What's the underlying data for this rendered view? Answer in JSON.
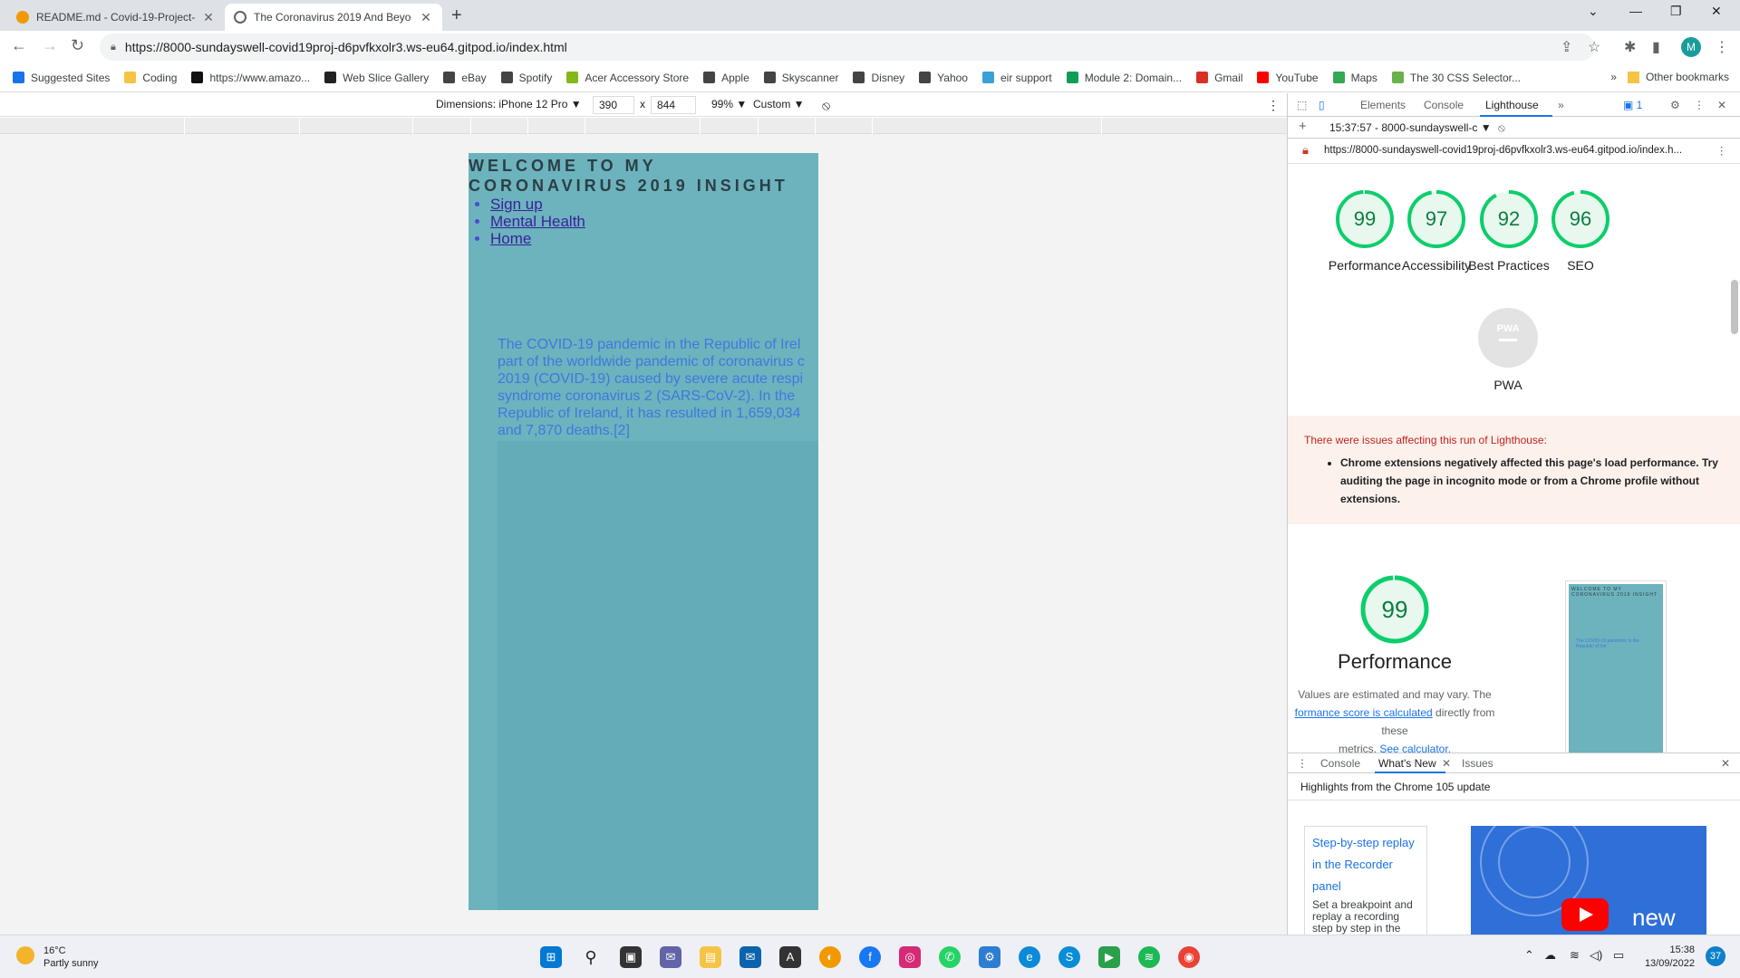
{
  "browser": {
    "tabs": [
      {
        "title": "README.md - Covid-19-Project-",
        "favicon_color": "#f29900"
      },
      {
        "title": "The Coronavirus 2019 And Beyo",
        "favicon_color": "#5f6368"
      }
    ],
    "url": "https://8000-sundayswell-covid19proj-d6pvfkxolr3.ws-eu64.gitpod.io/index.html",
    "profile_initial": "M"
  },
  "bookmarks": {
    "items": [
      {
        "label": "Suggested Sites",
        "icon": "search-icon",
        "color": "#1a73e8"
      },
      {
        "label": "Coding",
        "icon": "folder-icon",
        "color": "#f6c445"
      },
      {
        "label": "https://www.amazo...",
        "icon": "amazon-icon",
        "color": "#111111"
      },
      {
        "label": "Web Slice Gallery",
        "icon": "web-slice-icon",
        "color": "#222222"
      },
      {
        "label": "eBay",
        "icon": "globe-icon",
        "color": "#444444"
      },
      {
        "label": "Spotify",
        "icon": "globe-icon",
        "color": "#444444"
      },
      {
        "label": "Acer Accessory Store",
        "icon": "acer-icon",
        "color": "#83b81a"
      },
      {
        "label": "Apple",
        "icon": "apple-icon",
        "color": "#444444"
      },
      {
        "label": "Skyscanner",
        "icon": "globe-icon",
        "color": "#444444"
      },
      {
        "label": "Disney",
        "icon": "globe-icon",
        "color": "#444444"
      },
      {
        "label": "Yahoo",
        "icon": "globe-icon",
        "color": "#444444"
      },
      {
        "label": "eir support",
        "icon": "eir-icon",
        "color": "#3aa0d8"
      },
      {
        "label": "Module 2: Domain...",
        "icon": "drive-icon",
        "color": "#0f9d58"
      },
      {
        "label": "Gmail",
        "icon": "gmail-icon",
        "color": "#d93025"
      },
      {
        "label": "YouTube",
        "icon": "youtube-icon",
        "color": "#ff0000"
      },
      {
        "label": "Maps",
        "icon": "maps-icon",
        "color": "#34a853"
      },
      {
        "label": "The 30 CSS Selector...",
        "icon": "leaf-icon",
        "color": "#6ab04c"
      }
    ],
    "more": "»",
    "other": "Other bookmarks"
  },
  "device_toolbar": {
    "dimensions": "Dimensions: iPhone 12 Pro ▼",
    "width": "390",
    "times": "x",
    "height": "844",
    "zoom": "99% ▼",
    "throttle": "Custom ▼"
  },
  "site": {
    "title": "WELCOME TO MY CORONAVIRUS 2019 INSIGHT",
    "nav": [
      "Sign up",
      "Mental Health",
      "Home"
    ],
    "body_lines": [
      "The COVID-19 pandemic in the Republic of Irel",
      "part of the worldwide pandemic of coronavirus c",
      "2019 (COVID-19) caused by severe acute respi",
      "syndrome coronavirus 2 (SARS-CoV-2). In the",
      "Republic of Ireland, it has resulted in 1,659,034",
      "and 7,870 deaths.[2]"
    ]
  },
  "devtools": {
    "tabs": [
      "Elements",
      "Console",
      "Lighthouse"
    ],
    "selected_tab": "Lighthouse",
    "more": "»",
    "issues_count": "1",
    "report_select": "15:37:57 - 8000-sundayswell-c ▼",
    "report_url": "https://8000-sundayswell-covid19proj-d6pvfkxolr3.ws-eu64.gitpod.io/index.h...",
    "scores": [
      {
        "label": "Performance",
        "value": 99
      },
      {
        "label": "Accessibility",
        "value": 97
      },
      {
        "label": "Best Practices",
        "value": 92
      },
      {
        "label": "SEO",
        "value": 96
      }
    ],
    "pwa_label": "PWA",
    "pwa_badge": "PWA",
    "warning_heading": "There were issues affecting this run of Lighthouse:",
    "warning_item": "Chrome extensions negatively affected this page's load performance. Try auditing the page in incognito mode or from a Chrome profile without extensions.",
    "perf_score": 99,
    "perf_title": "Performance",
    "perf_desc_1": "Values are estimated and may vary. The",
    "perf_link_1": "formance score is calculated",
    "perf_desc_2": "directly from these",
    "perf_desc_3": "metrics.",
    "perf_link_2": "See calculator.",
    "gauge_color": "#0cce6b",
    "drawer_tabs": [
      "Console",
      "What's New",
      "Issues"
    ],
    "drawer_heading": "Highlights from the Chrome 105 update",
    "card_title": "Step-by-step replay in the Recorder panel",
    "card_desc": "Set a breakpoint and replay a recording step by step in the Recorder panel",
    "video_text": "new"
  },
  "taskbar": {
    "temperature": "16°C",
    "weather": "Partly sunny",
    "time": "15:38",
    "date": "13/09/2022",
    "notifications": "37"
  }
}
